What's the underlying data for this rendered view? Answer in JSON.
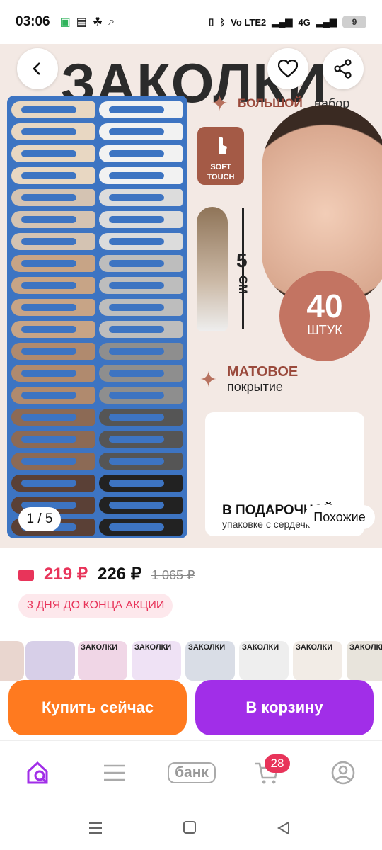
{
  "status_bar": {
    "time": "03:06",
    "network": "Vo LTE2",
    "signal_label": "4G",
    "battery": "9"
  },
  "hero": {
    "title": "ЗАКОЛКИ",
    "label_big": "БОЛЬШОЙ",
    "label_set": "набор",
    "soft_touch": "SOFT TOUCH",
    "size_value": "5",
    "size_unit": "СМ",
    "count_value": "40",
    "count_unit": "ШТУК",
    "matte_title": "МАТОВОЕ",
    "matte_sub": "покрытие",
    "gift_title": "В ПОДАРОЧНОЙ",
    "gift_sub": "упаковке с сердечками",
    "page_indicator": "1 / 5",
    "similar_button": "Похожие"
  },
  "price": {
    "wallet_price": "219 ₽",
    "regular_price": "226 ₽",
    "old_price": "1 065 ₽"
  },
  "promo": "3 ДНЯ ДО КОНЦА АКЦИИ",
  "thumbnails": [
    {
      "label": ""
    },
    {
      "label": ""
    },
    {
      "label": "ЗАКОЛКИ"
    },
    {
      "label": "ЗАКОЛКИ"
    },
    {
      "label": "ЗАКОЛКИ"
    },
    {
      "label": "ЗАКОЛКИ"
    },
    {
      "label": "ЗАКОЛКИ"
    },
    {
      "label": "ЗАКОЛКИ"
    }
  ],
  "actions": {
    "buy_now": "Купить сейчас",
    "add_to_cart": "В корзину"
  },
  "bottom_nav": {
    "bank": "банк",
    "cart_count": "28"
  },
  "colors": {
    "price": "#e8345a",
    "buy": "#ff7a1f",
    "cart": "#a12ee8",
    "accent": "#a12ee8"
  }
}
